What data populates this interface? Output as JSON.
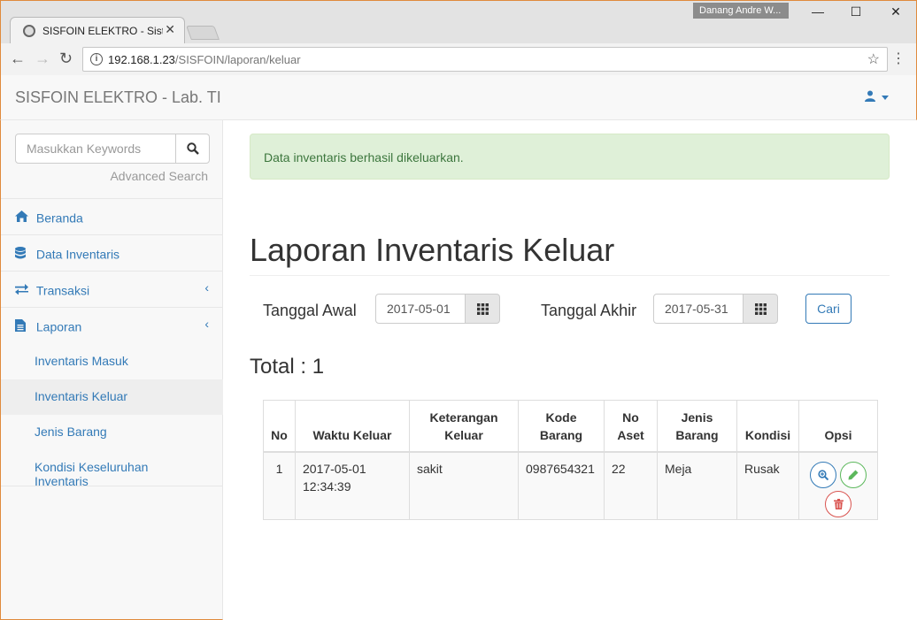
{
  "browser": {
    "tab_title": "SISFOIN ELEKTRO - Sistem",
    "profile_name": "Danang Andre W...",
    "url_host": "192.168.1.23",
    "url_path": "/SISFOIN/laporan/keluar"
  },
  "navbar": {
    "brand": "SISFOIN ELEKTRO - Lab. TI"
  },
  "sidebar": {
    "search_placeholder": "Masukkan Keywords",
    "advanced_search": "Advanced Search",
    "items": [
      {
        "label": "Beranda",
        "icon": "home-icon"
      },
      {
        "label": "Data Inventaris",
        "icon": "database-icon"
      },
      {
        "label": "Transaksi",
        "icon": "exchange-icon"
      },
      {
        "label": "Laporan",
        "icon": "file-icon"
      }
    ],
    "laporan_sub": [
      {
        "label": "Inventaris Masuk"
      },
      {
        "label": "Inventaris Keluar",
        "active": true
      },
      {
        "label": "Jenis Barang"
      },
      {
        "label": "Kondisi Keseluruhan Inventaris"
      }
    ]
  },
  "alert": {
    "message": "Data inventaris berhasil dikeluarkan."
  },
  "page": {
    "title": "Laporan Inventaris Keluar",
    "tanggal_awal_label": "Tanggal Awal",
    "tanggal_awal_value": "2017-05-01",
    "tanggal_akhir_label": "Tanggal Akhir",
    "tanggal_akhir_value": "2017-05-31",
    "cari_label": "Cari",
    "total": "Total : 1"
  },
  "table": {
    "headers": [
      "No",
      "Waktu Keluar",
      "Keterangan Keluar",
      "Kode Barang",
      "No Aset",
      "Jenis Barang",
      "Kondisi",
      "Opsi"
    ],
    "rows": [
      {
        "no": "1",
        "waktu": "2017-05-01 12:34:39",
        "keterangan": "sakit",
        "kode": "0987654321",
        "no_aset": "22",
        "jenis": "Meja",
        "kondisi": "Rusak"
      }
    ]
  },
  "colors": {
    "primary": "#337ab7",
    "success": "#5cb85c",
    "danger": "#d9534f",
    "alert_bg": "#dff0d8",
    "alert_text": "#3c763d"
  }
}
